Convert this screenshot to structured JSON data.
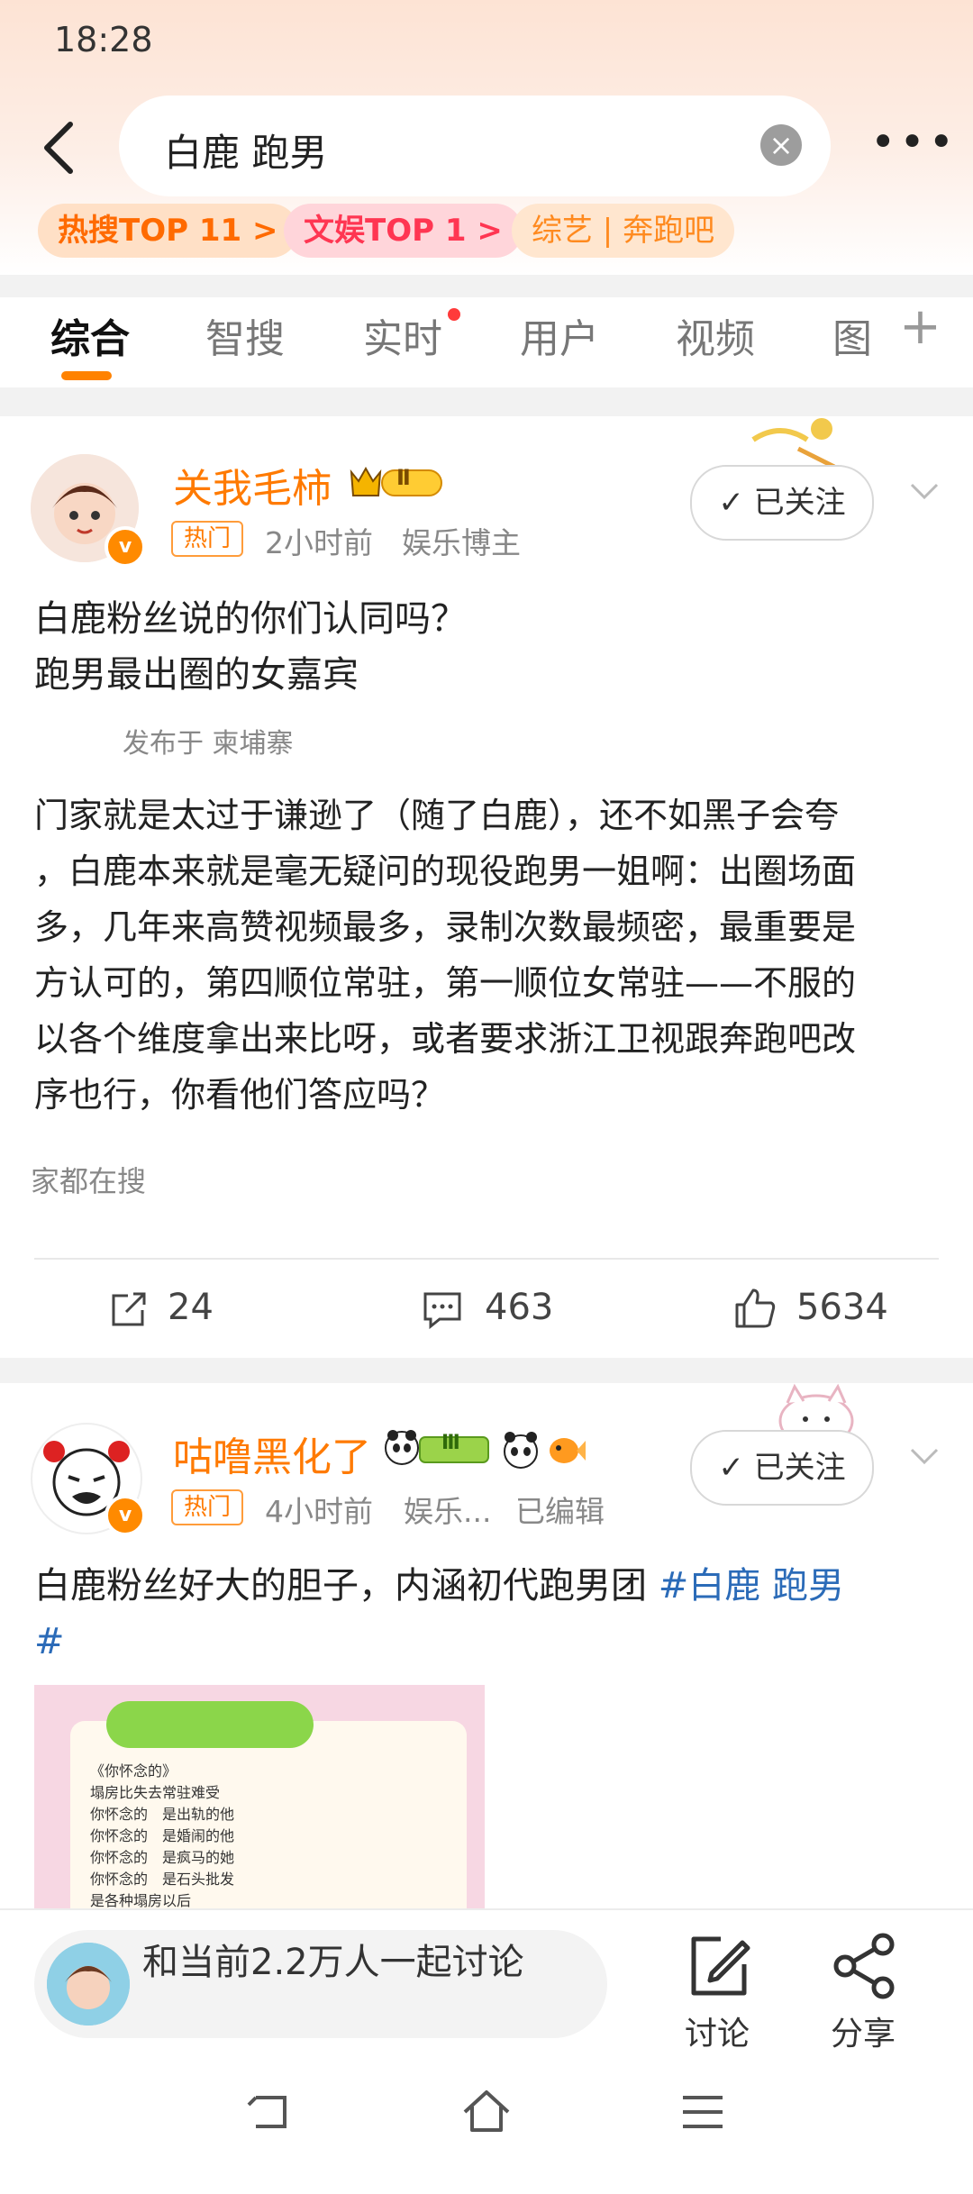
{
  "status_bar": {
    "time": "18:28"
  },
  "search": {
    "query": "白鹿 跑男"
  },
  "chips": [
    "热搜TOP 11 >",
    "文娱TOP 1 >",
    "综艺 | 奔跑吧"
  ],
  "tabs": [
    "综合",
    "智搜",
    "实时",
    "用户",
    "视频",
    "图"
  ],
  "posts": [
    {
      "username": "关我毛柿",
      "badge_label": "Ⅱ",
      "hot_label": "热门",
      "time": "2小时前",
      "source": "娱乐博主",
      "follow_label": "已关注",
      "text_line1": "白鹿粉丝说的你们认同吗？",
      "text_line2": "跑男最出圈的女嘉宾",
      "location": "发布于 柬埔寨",
      "body_lines": [
        "门家就是太过于谦逊了（随了白鹿），还不如黑子会夸",
        "，白鹿本来就是毫无疑问的现役跑男一姐啊：出圈场面",
        "多，几年来高赞视频最多，录制次数最频密，最重要是",
        "方认可的，第四顺位常驻，第一顺位女常驻——不服的",
        "以各个维度拿出来比呀，或者要求浙江卫视跟奔跑吧改",
        "序也行，你看他们答应吗？"
      ],
      "search_hint": "家都在搜",
      "reposts": "24",
      "comments": "463",
      "likes": "5634"
    },
    {
      "username": "咕噜黑化了",
      "badge_label": "Ⅲ",
      "hot_label": "热门",
      "time": "4小时前",
      "source": "娱乐...",
      "edited": "已编辑",
      "follow_label": "已关注",
      "text_main": "白鹿粉丝好大的胆子，内涵初代跑男团 ",
      "text_tag": "#白鹿 跑男",
      "text_tag_end": "#",
      "image_title": "《你怀念的》",
      "image_lines": [
        "塌房比失去常驻难受",
        "你怀念的　是出轨的他",
        "你怀念的　是婚闹的他",
        "你怀念的　是疯马的她",
        "你怀念的　是石头批发",
        "是各种塌房以后"
      ]
    }
  ],
  "bottom": {
    "discuss_text": "和当前2.2万人一起讨论",
    "discuss_label": "讨论",
    "share_label": "分享"
  }
}
